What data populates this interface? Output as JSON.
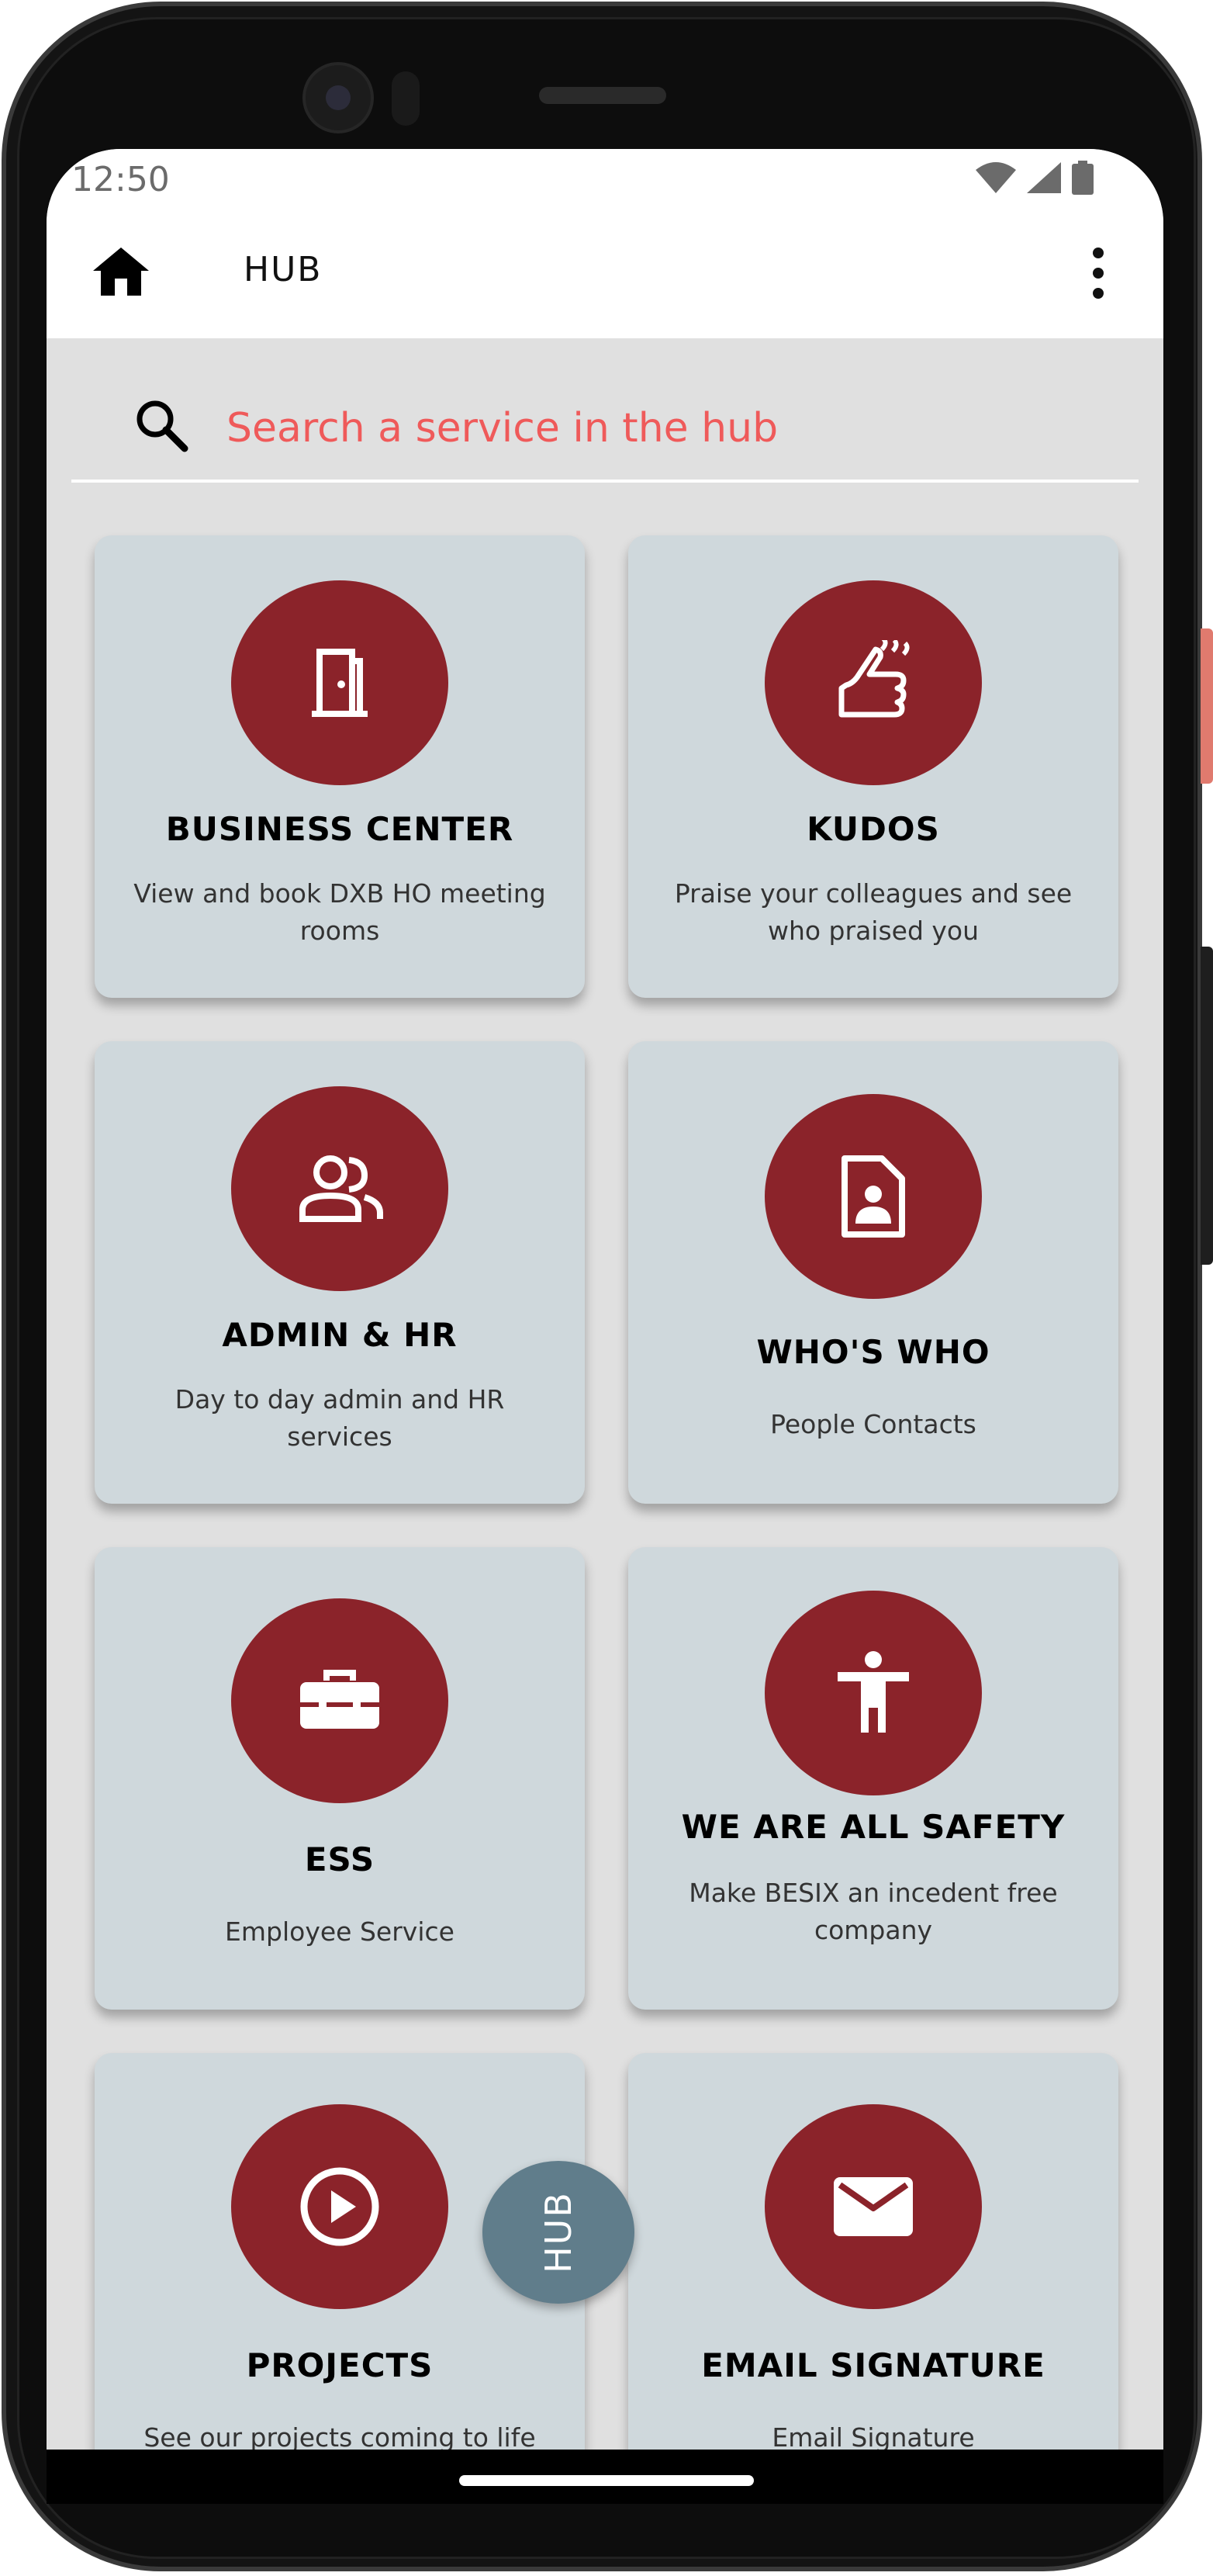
{
  "status_bar": {
    "time": "12:50"
  },
  "app_bar": {
    "title": "HUB"
  },
  "search": {
    "placeholder": "Search a service in the hub"
  },
  "cards": [
    {
      "title": "BUSINESS CENTER",
      "description": "View and book DXB HO meeting rooms",
      "icon": "door-icon"
    },
    {
      "title": "KUDOS",
      "description": "Praise your colleagues and see who praised you",
      "icon": "hand-praise-icon"
    },
    {
      "title": "ADMIN & HR",
      "description": "Day to day admin and HR services",
      "icon": "people-icon"
    },
    {
      "title": "WHO'S WHO",
      "description": "People Contacts",
      "icon": "contact-file-icon"
    },
    {
      "title": "ESS",
      "description": "Employee Service",
      "icon": "toolbox-icon"
    },
    {
      "title": "WE ARE ALL SAFETY",
      "description": "Make BESIX an incedent free company",
      "icon": "person-icon"
    },
    {
      "title": "PROJECTS",
      "description": "See our projects coming to life",
      "icon": "play-circle-icon"
    },
    {
      "title": "EMAIL SIGNATURE",
      "description": "Email Signature",
      "icon": "mail-icon"
    }
  ],
  "fab": {
    "label": "HUB"
  },
  "colors": {
    "accent": "#8b232a",
    "card": "#cfd8dc",
    "fab": "#607d8b",
    "search_text": "#ef5a5a",
    "background": "#e0e0e0"
  }
}
